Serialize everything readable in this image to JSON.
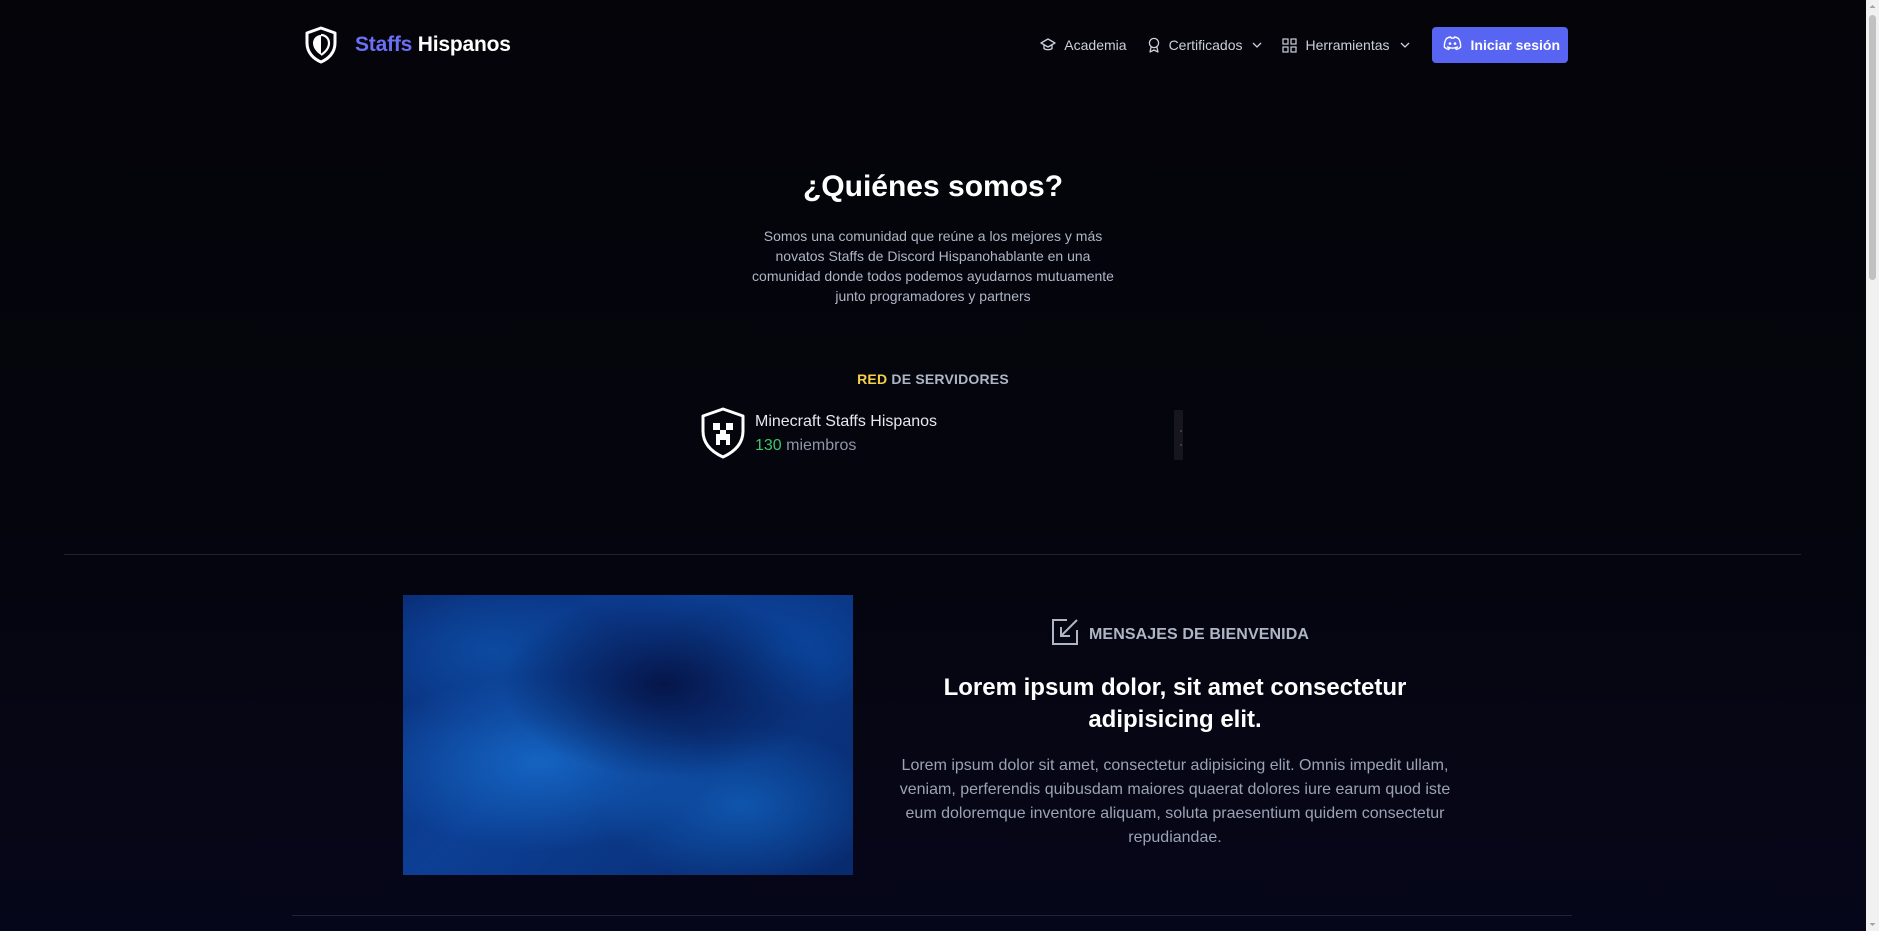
{
  "navbar": {
    "brand": {
      "accent": "Staffs",
      "rest": "Hispanos"
    },
    "links": [
      {
        "label": "Academia",
        "icon": "graduation-cap-icon"
      },
      {
        "label": "Certificados",
        "icon": "award-icon",
        "dropdown": true
      },
      {
        "label": "Herramientas",
        "icon": "grid-icon",
        "dropdown": true
      }
    ],
    "login_label": "Iniciar sesión",
    "login_icon": "discord-icon"
  },
  "hero": {
    "title": "¿Quiénes somos?",
    "description": "Somos una comunidad que reúne a los mejores y más novatos Staffs de Discord Hispanohablante en una comunidad donde todos podemos ayudarnos mutuamente junto programadores y partners"
  },
  "network": {
    "label_highlight": "RED",
    "label_rest": " DE SERVIDORES",
    "servers": [
      {
        "name": "Minecraft Staffs Hispanos",
        "member_count": "130",
        "member_suffix": " miembros",
        "icon": "minecraft-shield-icon"
      }
    ]
  },
  "feature": {
    "tag": "MENSAJES DE BIENVENIDA",
    "tag_icon": "arrow-down-left-box-icon",
    "title": "Lorem ipsum dolor, sit amet consectetur adipisicing elit.",
    "description": "Lorem ipsum dolor sit amet, consectetur adipisicing elit. Omnis impedit ullam, veniam, perferendis quibusdam maiores quaerat dolores iure earum quod iste eum doloremque inventore aliquam, soluta praesentium quidem consectetur repudiandae."
  },
  "colors": {
    "background": "#05050d",
    "brand_accent": "#6a6ff5",
    "discord_button": "#5865f2",
    "highlight_yellow": "#f5d04a",
    "member_green": "#3fc46b",
    "muted_text": "#aeb6c6"
  }
}
